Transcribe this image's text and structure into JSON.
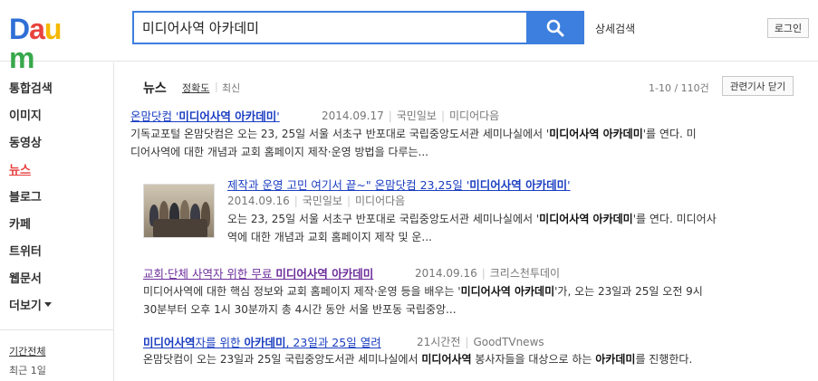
{
  "header": {
    "logo_letters": [
      "D",
      "a",
      "u",
      "m"
    ],
    "logo_colors": [
      "#2f6fd6",
      "#e8423d",
      "#f5b800",
      "#37a84b"
    ],
    "search_value": "미디어사역 아카데미",
    "search_icon": "magnifier",
    "advanced_search": "상세검색",
    "login": "로그인"
  },
  "sidebar": {
    "items": [
      {
        "label": "통합검색"
      },
      {
        "label": "이미지"
      },
      {
        "label": "동영상"
      },
      {
        "label": "뉴스"
      },
      {
        "label": "블로그"
      },
      {
        "label": "카페"
      },
      {
        "label": "트위터"
      },
      {
        "label": "웹문서"
      },
      {
        "label": "더보기"
      }
    ],
    "active_index": 3,
    "period_title": "기간전체",
    "period_option": "최근 1일"
  },
  "news": {
    "heading": "뉴스",
    "sort_active": "정확도",
    "sort_other": "최신",
    "count": "1-10 / 110건",
    "fold_button": "관련기사 닫기",
    "results": [
      {
        "title_pre": "온맘닷컴 '",
        "title_bold": "미디어사역 아카데미",
        "title_post": "'",
        "date": "2014.09.17",
        "source": "국민일보",
        "source2": "미디어다음",
        "line1_pre": "기독교포털 온맘닷컴은 오는 23, 25일 서울 서초구 반포대로 국립중앙도서관 세미나실에서 '",
        "line1_bold": "미디어사역 아카데미",
        "line1_post": "'를 연다. 미",
        "line2": "디어사역에 대한 개념과 교회 홈페이지 제작·운영 방법을 다루는..."
      },
      {
        "title_pre": "제작과 운영 고민 여기서 끝~\" 온맘닷컴 23,25일 '",
        "title_bold": "미디어사역 아카데미",
        "title_post": "'",
        "date": "2014.09.16",
        "source": "국민일보",
        "source2": "미디어다음",
        "line1_pre": "오는 23, 25일 서울 서초구 반포대로 국립중앙도서관 세미나실에서 '",
        "line1_bold": "미디어사역 아카데미",
        "line1_post": "'를 연다. 미디어사",
        "line2": "역에 대한 개념과 교회 홈페이지 제작 및 운..."
      },
      {
        "title_pre": "교회·단체 사역자 위한 무료 ",
        "title_bold": "미디어사역 아카데미",
        "title_post": "",
        "date": "2014.09.16",
        "source": "크리스천투데이",
        "line1_pre": "미디어사역에 대한 핵심 정보와 교회 홈페이지 제작·운영 등을 배우는 '",
        "line1_bold": "미디어사역 아카데미",
        "line1_post": "'가, 오는 23일과 25일 오전 9시",
        "line2": "30분부터 오후 1시 30분까지 총 4시간 동안 서울 반포동 국립중앙..."
      },
      {
        "title_bold": "미디어사역",
        "title_mid": "자를 위한 ",
        "title_bold2": "아카데미",
        "title_post": ", 23일과 25일 열려",
        "date": "21시간전",
        "source": "GoodTVnews",
        "line1_pre": "온맘닷컴이 오는 23일과 25일 국립중앙도서관 세미나실에서 ",
        "line1_bold": "미디어사역",
        "line1_mid": " 봉사자들을 대상으로 하는 ",
        "line1_bold2": "아카데미",
        "line1_post": "를 진행한다."
      }
    ]
  }
}
